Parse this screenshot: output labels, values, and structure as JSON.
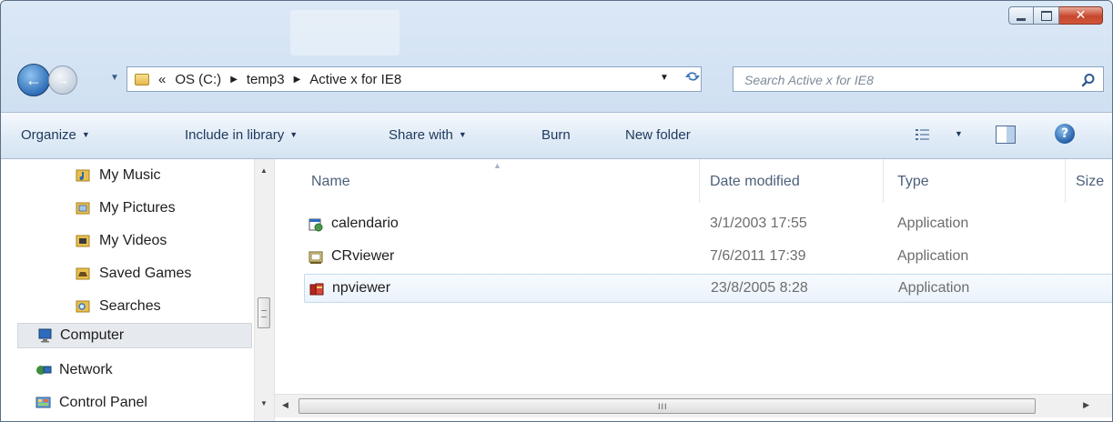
{
  "address_bar": {
    "overflow_label": "«",
    "breadcrumbs": [
      "OS (C:)",
      "temp3",
      "Active x for IE8"
    ]
  },
  "search": {
    "placeholder": "Search Active x for IE8"
  },
  "toolbar": {
    "organize": "Organize",
    "include_in_library": "Include in library",
    "share_with": "Share with",
    "burn": "Burn",
    "new_folder": "New folder"
  },
  "nav_pane": {
    "items": [
      {
        "label": "My Music",
        "icon": "music-folder-icon"
      },
      {
        "label": "My Pictures",
        "icon": "pictures-folder-icon"
      },
      {
        "label": "My Videos",
        "icon": "videos-folder-icon"
      },
      {
        "label": "Saved Games",
        "icon": "saved-games-icon"
      },
      {
        "label": "Searches",
        "icon": "searches-folder-icon"
      },
      {
        "label": "Computer",
        "icon": "computer-icon",
        "selected": true
      },
      {
        "label": "Network",
        "icon": "network-icon"
      },
      {
        "label": "Control Panel",
        "icon": "control-panel-icon"
      }
    ]
  },
  "file_list": {
    "columns": {
      "name": "Name",
      "date_modified": "Date modified",
      "type": "Type",
      "size": "Size"
    },
    "files": [
      {
        "name": "calendario",
        "date": "3/1/2003 17:55",
        "type": "Application",
        "icon": "calendario-app-icon"
      },
      {
        "name": "CRviewer",
        "date": "7/6/2011 17:39",
        "type": "Application",
        "icon": "crviewer-app-icon"
      },
      {
        "name": "npviewer",
        "date": "23/8/2005 8:28",
        "type": "Application",
        "icon": "npviewer-app-icon",
        "selected": true
      }
    ]
  },
  "colors": {
    "accent": "#3f78b8",
    "selection": "#eaf2fb",
    "close_button": "#c7472e"
  }
}
